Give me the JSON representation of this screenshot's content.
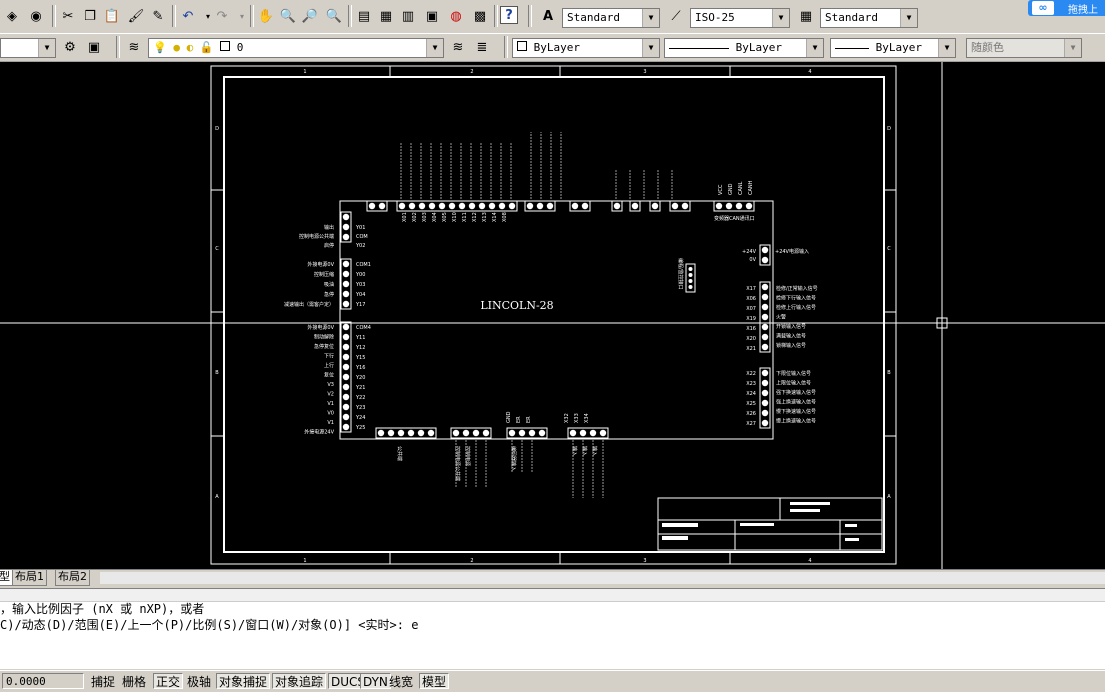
{
  "toolbar1": {
    "text_style": "Standard",
    "dim_style": "ISO-25",
    "table_style": "Standard",
    "right_corner_label": "拖拽上"
  },
  "toolbar2": {
    "layer_value": "0",
    "color": "ByLayer",
    "linetype": "ByLayer",
    "lineweight": "ByLayer",
    "plot_style": "随颜色"
  },
  "drawing": {
    "title": "LINCOLN-28",
    "col_numbers": [
      "1",
      "2",
      "3",
      "4"
    ],
    "row_letters": [
      "D",
      "C",
      "B",
      "A"
    ],
    "left_top_labels": [
      "输出",
      "控制电源公共端",
      "启停"
    ],
    "left_top_ids": [
      "Y01",
      "COM",
      "Y02"
    ],
    "left_mid_labels": [
      "外接电源0V",
      "控制压缩",
      "吸油",
      "急停",
      "减速输出（需客户定）"
    ],
    "left_mid_ids": [
      "COM1",
      "Y00",
      "Y03",
      "Y04",
      "Y17"
    ],
    "left_bot_labels": [
      "外接电源0V",
      "制动解除",
      "急停复位",
      "下行",
      "上行",
      "复位",
      "V3",
      "V2",
      "V1",
      "V0",
      "V1",
      "外接电源24V"
    ],
    "left_bot_ids": [
      "COM4",
      "Y11",
      "Y12",
      "Y15",
      "Y16",
      "Y20",
      "Y21",
      "Y22",
      "Y23",
      "Y24",
      "Y25"
    ],
    "right_power_label": "+24V电源输入",
    "right_power_ids": [
      "+24V",
      "0V"
    ],
    "right_mid_labels": [
      "检修/正常输入信号",
      "检修下行输入信号",
      "检修上行输入信号",
      "火警",
      "开锁输入信号",
      "满载输入信号",
      "锁梯输入信号"
    ],
    "right_mid_ids": [
      "X17",
      "X06",
      "X07",
      "X19",
      "X16",
      "X20",
      "X21"
    ],
    "right_bot_labels": [
      "下限位输入信号",
      "上限位输入信号",
      "强下换速输入信号",
      "强上换速输入信号",
      "慢下换速输入信号",
      "慢上换速输入信号"
    ],
    "right_bot_ids": [
      "X22",
      "X23",
      "X24",
      "X25",
      "X26",
      "X27"
    ],
    "top_ids": [
      "X01",
      "X02",
      "X03",
      "X04",
      "X05",
      "X10",
      "X11",
      "X12",
      "X13",
      "X14",
      "X08"
    ],
    "top_can_label": "变频器CAN通讯口",
    "top_can_ids": [
      "VCC",
      "GND",
      "CANL",
      "CANH"
    ],
    "bottom_labels": [
      "公共端",
      "控制电源公共端",
      "控制电源",
      "编码器输入",
      "输入",
      "输入",
      "输入"
    ],
    "bottom_ids": [
      "GND",
      "ER",
      "ER",
      "X32",
      "X33",
      "X34"
    ],
    "inner_side_label": "编程/监控接口"
  },
  "tabs": [
    "型",
    "布局1",
    "布局2"
  ],
  "command": {
    "line1": "，输入比例因子 (nX 或 nXP)，或者",
    "line2": "C)/动态(D)/范围(E)/上一个(P)/比例(S)/窗口(W)/对象(O)] <实时>: e"
  },
  "status": {
    "coords": "0.0000",
    "buttons": [
      {
        "label": "捕捉",
        "on": false
      },
      {
        "label": "栅格",
        "on": false
      },
      {
        "label": "正交",
        "on": true
      },
      {
        "label": "极轴",
        "on": false
      },
      {
        "label": "对象捕捉",
        "on": true
      },
      {
        "label": "对象追踪",
        "on": true
      },
      {
        "label": "DUCS",
        "on": true
      },
      {
        "label": "DYN",
        "on": true
      },
      {
        "label": "线宽",
        "on": false
      },
      {
        "label": "模型",
        "on": true
      }
    ]
  }
}
